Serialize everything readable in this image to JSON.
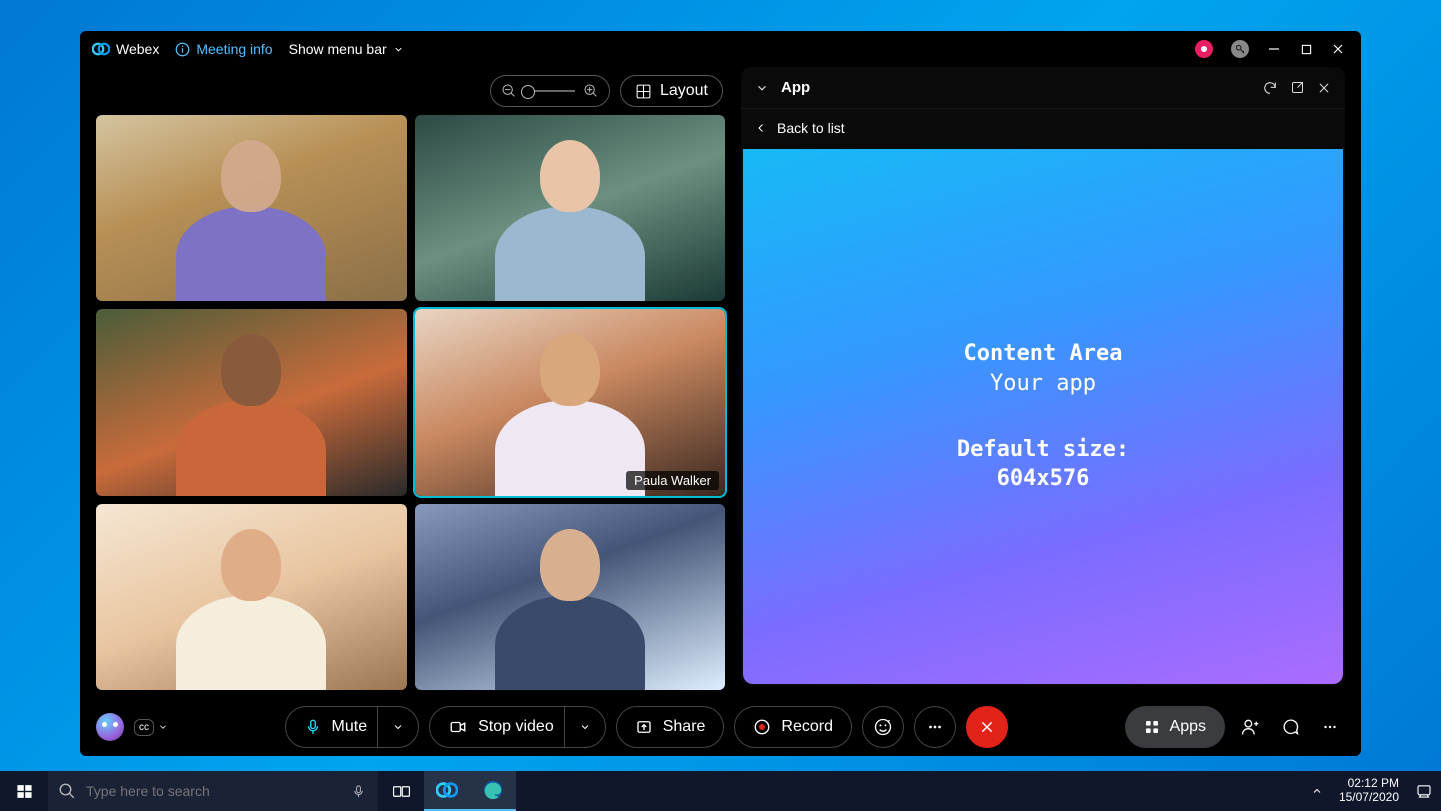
{
  "titlebar": {
    "app_name": "Webex",
    "meeting_info": "Meeting info",
    "show_menu": "Show menu bar"
  },
  "layout": {
    "button_label": "Layout"
  },
  "participants": [
    {
      "name": ""
    },
    {
      "name": ""
    },
    {
      "name": ""
    },
    {
      "name": "Paula Walker",
      "active": true
    },
    {
      "name": ""
    },
    {
      "name": ""
    }
  ],
  "app_panel": {
    "title": "App",
    "back": "Back to list",
    "content_title": "Content Area",
    "content_sub": "Your app",
    "default_size_label": "Default size:",
    "default_size_value": "604x576"
  },
  "toolbar": {
    "mute": "Mute",
    "stop_video": "Stop video",
    "share": "Share",
    "record": "Record",
    "apps": "Apps"
  },
  "taskbar": {
    "search_placeholder": "Type here to search",
    "time": "02:12 PM",
    "date": "15/07/2020"
  }
}
